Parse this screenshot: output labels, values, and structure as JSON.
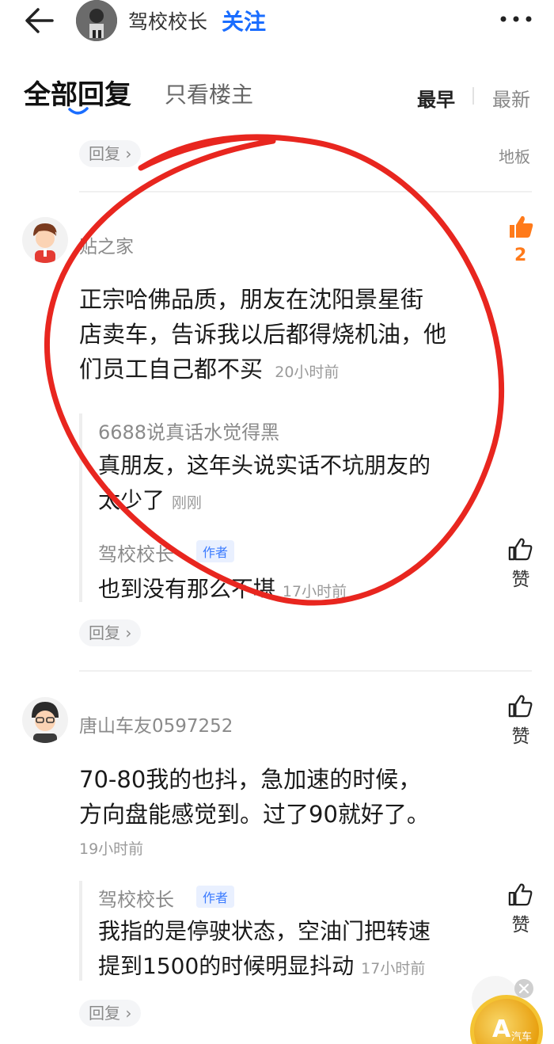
{
  "topbar": {
    "username": "驾校校长",
    "follow_label": "关注"
  },
  "tabs": {
    "all": "全部回复",
    "op_only": "只看楼主",
    "sort_earliest": "最早",
    "sort_newest": "最新"
  },
  "first_reply_pill": "回复",
  "floor_label": "地板",
  "comments": [
    {
      "username": "贴之家",
      "text_lines": [
        "正宗哈佛品质，朋友在沈阳景星街",
        "店卖车，告诉我以后都得烧机油，他",
        "们员工自己都不买"
      ],
      "time": "20小时前",
      "likes": "2",
      "replies": [
        {
          "username": "6688说真话水觉得黑",
          "text_lines": [
            "真朋友，这年头说实话不坑朋友的",
            "太少了"
          ],
          "time": "刚刚"
        },
        {
          "username": "驾校校长",
          "badge": "作者",
          "text": "也到没有那么不堪",
          "time": "17小时前",
          "like_label": "赞"
        }
      ],
      "reply_pill": "回复"
    },
    {
      "username": "唐山车友0597252",
      "text_lines": [
        "70-80我的也抖，急加速的时候，",
        "方向盘能感觉到。过了90就好了。"
      ],
      "time": "19小时前",
      "like_label": "赞",
      "replies": [
        {
          "username": "驾校校长",
          "badge": "作者",
          "text_lines": [
            "我指的是停驶状态，空油门把转速",
            "提到1500的时候明显抖动"
          ],
          "time": "17小时前",
          "like_label": "赞"
        }
      ],
      "reply_pill": "回复"
    }
  ],
  "widget": {
    "coin_letter": "A",
    "watermark": "汽车"
  },
  "colors": {
    "accent_blue": "#1a6dff",
    "like_orange": "#ff7a1a",
    "annotation_red": "#e8261f"
  }
}
